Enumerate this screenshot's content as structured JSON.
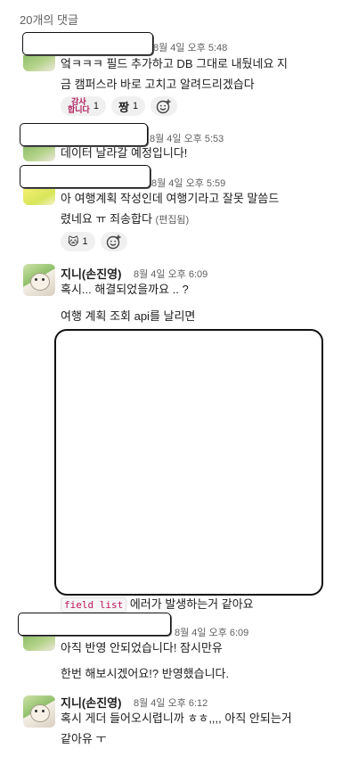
{
  "top_date_fragment": "20개의 댓글",
  "messages": [
    {
      "timestamp": "8월 4일 오후 5:48",
      "lines": [
        "엌ㅋㅋㅋ 필드 추가하고 DB 그대로 내뒀네요 지",
        "금 캠퍼스라 바로 고치고 알려드리겠습다"
      ],
      "reactions": [
        {
          "emoji_text": "감사\n합니다",
          "count": "1"
        },
        {
          "emoji_text": "짱",
          "count": "1"
        }
      ]
    },
    {
      "timestamp": "8월 4일 오후 5:53",
      "lines": [
        "데이터 날라갈 예정입니다!"
      ]
    },
    {
      "timestamp": "8월 4일 오후 5:59",
      "lines": [
        "아 여행계획 작성인데 여행기라고 잘못 말씀드",
        "렸네요 ㅠ 죄송합다"
      ],
      "edited": "(편집됨)",
      "reactions": [
        {
          "emoji_text": "🐱",
          "count": "1"
        }
      ]
    },
    {
      "author": "지니(손진영)",
      "timestamp": "8월 4일 오후 6:09",
      "lines": [
        "혹시... 해결되었을까요 .. ?"
      ],
      "followups": [
        "여행 계획 조회 api를 날리면"
      ],
      "after_image": {
        "code": "field list",
        "text": " 에러가 발생하는거 같아요"
      }
    },
    {
      "timestamp": "8월 4일 오후 6:09",
      "lines": [
        "아직 반영 안되었습니다! 잠시만유"
      ],
      "followups": [
        "한번 해보시겠어요!? 반영했습니다."
      ]
    },
    {
      "author": "지니(손진영)",
      "timestamp": "8월 4일 오후 6:12",
      "lines": [
        "혹시 게더 들어오시렵니까 ㅎㅎ,,,, 아직 안되는거",
        "같아유 ㅜ"
      ]
    }
  ]
}
